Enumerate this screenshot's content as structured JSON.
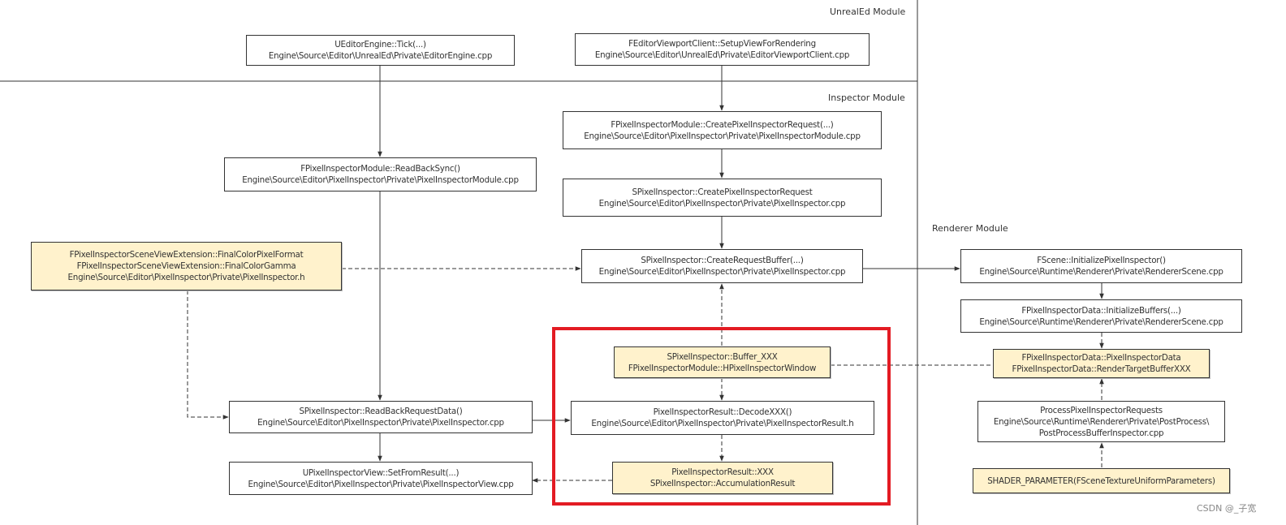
{
  "modules": {
    "unrealed": "UnrealEd Module",
    "inspector": "Inspector Module",
    "renderer": "Renderer Module"
  },
  "nodes": {
    "editor_tick": [
      "UEditorEngine::Tick(...)",
      "Engine\\Source\\Editor\\UnrealEd\\Private\\EditorEngine.cpp"
    ],
    "viewport_setup": [
      "FEditorViewportClient::SetupViewForRendering",
      "Engine\\Source\\Editor\\UnrealEd\\Private\\EditorViewportClient.cpp"
    ],
    "create_request_module": [
      "FPixelInspectorModule::CreatePixelInspectorRequest(...)",
      "Engine\\Source\\Editor\\PixelInspector\\Private\\PixelInspectorModule.cpp"
    ],
    "readback_sync": [
      "FPixelInspectorModule::ReadBackSync()",
      "Engine\\Source\\Editor\\PixelInspector\\Private\\PixelInspectorModule.cpp"
    ],
    "create_request_s": [
      "SPixelInspector::CreatePixelInspectorRequest",
      "Engine\\Source\\Editor\\PixelInspector\\Private\\PixelInspector.cpp"
    ],
    "scene_view_ext": [
      "FPixelInspectorSceneViewExtension::FinalColorPixelFormat",
      "FPixelInspectorSceneViewExtension::FinalColorGamma",
      "Engine\\Source\\Editor\\PixelInspector\\Private\\PixelInspector.h"
    ],
    "create_request_buffer": [
      "SPixelInspector::CreateRequestBuffer(...)",
      "Engine\\Source\\Editor\\PixelInspector\\Private\\PixelInspector.cpp"
    ],
    "scene_init": [
      "FScene::InitializePixelInspector()",
      "Engine\\Source\\Runtime\\Renderer\\Private\\RendererScene.cpp"
    ],
    "data_init_buffers": [
      "FPixelInspectorData::InitializeBuffers(...)",
      "Engine\\Source\\Runtime\\Renderer\\Private\\RendererScene.cpp"
    ],
    "buffer_xxx": [
      "SPixelInspector::Buffer_XXX",
      "FPixelInspectorModule::HPixelInspectorWindow"
    ],
    "inspector_data": [
      "FPixelInspectorData::PixelInspectorData",
      "FPixelInspectorData::RenderTargetBufferXXX"
    ],
    "readback_request_data": [
      "SPixelInspector::ReadBackRequestData()",
      "Engine\\Source\\Editor\\PixelInspector\\Private\\PixelInspector.cpp"
    ],
    "decode_xxx": [
      "PixelInspectorResult::DecodeXXX()",
      "Engine\\Source\\Editor\\PixelInspector\\Private\\PixelInspectorResult.h"
    ],
    "process_requests": [
      "ProcessPixelInspectorRequests",
      "Engine\\Source\\Runtime\\Renderer\\Private\\PostProcess\\",
      "PostProcessBufferInspector.cpp"
    ],
    "set_from_result": [
      "UPixelInspectorView::SetFromResult(...)",
      "Engine\\Source\\Editor\\PixelInspector\\Private\\PixelInspectorView.cpp"
    ],
    "result_xxx": [
      "PixelInspectorResult::XXX",
      "SPixelInspector::AccumulationResult"
    ],
    "shader_param": [
      "SHADER_PARAMETER(FSceneTextureUniformParameters)"
    ]
  },
  "colors": {
    "highlight_fill": "#fff2cc",
    "highlight_frame": "#e31b23",
    "line": "#333333"
  },
  "watermark": "CSDN @_子宽"
}
